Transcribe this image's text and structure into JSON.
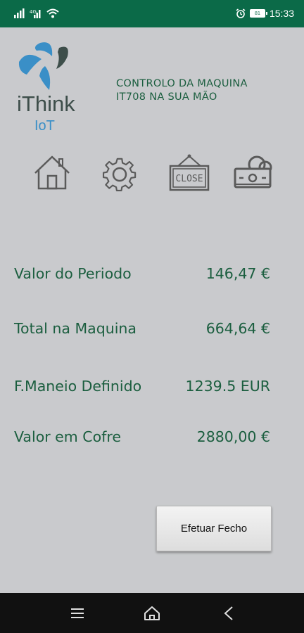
{
  "status_bar": {
    "time": "15:33",
    "battery_level": "81",
    "icons": [
      "sim-signal-icon",
      "sim2-signal-icon",
      "wifi-icon",
      "alarm-icon",
      "battery-icon"
    ]
  },
  "brand": {
    "name": "iThink",
    "sub": "IoT",
    "colors": {
      "blue": "#3a8fc7",
      "dark": "#3d4e4a"
    }
  },
  "header": {
    "line1": "CONTROLO DA MAQUINA",
    "line2": "IT708 NA SUA MÃO"
  },
  "nav_icons": [
    "home-icon",
    "settings-gear-icon",
    "close-sign-icon",
    "cash-money-icon"
  ],
  "rows": [
    {
      "label": "Valor do Periodo",
      "value": "146,47 €"
    },
    {
      "label": "Total na Maquina",
      "value": "664,64 €"
    },
    {
      "label": "F.Maneio Definido",
      "value": "1239.5 EUR"
    },
    {
      "label": "Valor em Cofre",
      "value": "2880,00 €"
    }
  ],
  "actions": {
    "close_button": "Efetuar Fecho"
  },
  "system_nav": [
    "recents-menu-icon",
    "home-nav-icon",
    "back-nav-icon"
  ],
  "theme": {
    "primary": "#0b6a48",
    "text": "#1b5e3f",
    "background": "#c9cacd"
  }
}
